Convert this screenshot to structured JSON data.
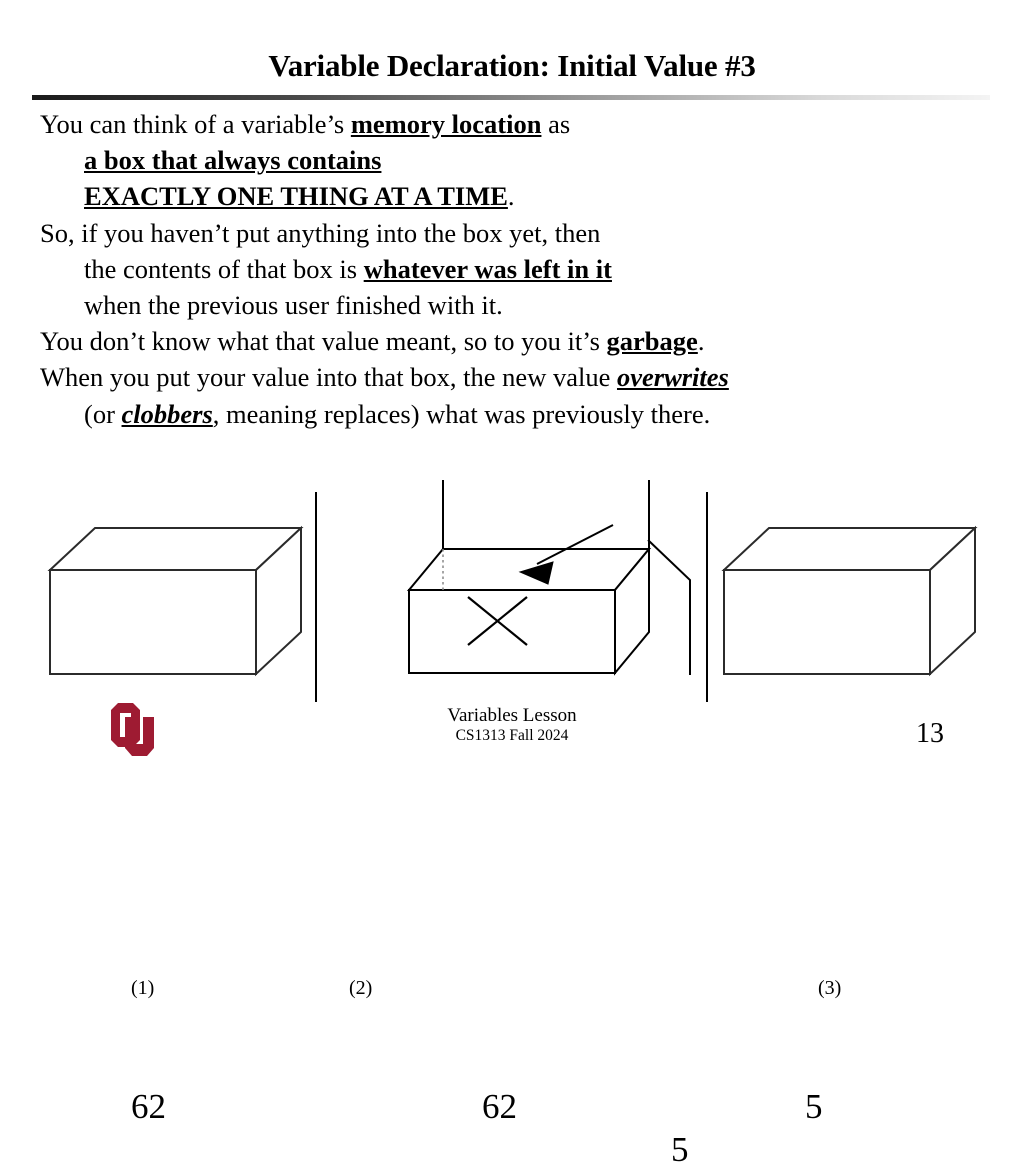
{
  "slide": {
    "title": "Variable Declaration: Initial Value #3",
    "page_number": "13"
  },
  "body": {
    "lines": [
      {
        "indent": 0,
        "segments": [
          {
            "text": "You can think of a variable’s ",
            "style": "plain"
          },
          {
            "text": "memory location",
            "style": "bold-underline"
          },
          {
            "text": " as",
            "style": "plain"
          }
        ]
      },
      {
        "indent": 1,
        "segments": [
          {
            "text": "a box that always contains",
            "style": "bold-underline"
          }
        ]
      },
      {
        "indent": 1,
        "segments": [
          {
            "text": "EXACTLY ONE THING AT A TIME",
            "style": "bold-underline"
          },
          {
            "text": ".",
            "style": "plain"
          }
        ]
      },
      {
        "indent": 0,
        "segments": [
          {
            "text": "So, if you haven’t put anything into the box yet, then",
            "style": "plain"
          }
        ]
      },
      {
        "indent": 1,
        "segments": [
          {
            "text": "the contents of that box is ",
            "style": "plain"
          },
          {
            "text": "whatever was left in it",
            "style": "bold-underline"
          }
        ]
      },
      {
        "indent": 1,
        "segments": [
          {
            "text": "when the previous user finished with it.",
            "style": "plain"
          }
        ]
      },
      {
        "indent": 0,
        "segments": [
          {
            "text": "You don’t know what that value meant, so to you it’s ",
            "style": "plain"
          },
          {
            "text": "garbage",
            "style": "bold-underline"
          },
          {
            "text": ".",
            "style": "plain"
          }
        ]
      },
      {
        "indent": 0,
        "segments": [
          {
            "text": "When you put your value into that box, the new value ",
            "style": "plain"
          },
          {
            "text": "overwrites",
            "style": "bold-italic-underline"
          }
        ]
      },
      {
        "indent": 1,
        "segments": [
          {
            "text": "(or ",
            "style": "plain"
          },
          {
            "text": "clobbers",
            "style": "bold-italic-underline"
          },
          {
            "text": ", meaning replaces) what was previously there.",
            "style": "plain"
          }
        ]
      }
    ]
  },
  "diagram": {
    "panels": [
      {
        "label": "(1)",
        "value": "62",
        "state": "closed-box-with-old-value"
      },
      {
        "label": "(2)",
        "value": "62",
        "crossed_out": true,
        "incoming_value": "5",
        "state": "open-box-value-crossed-out"
      },
      {
        "label": "(3)",
        "value": "5",
        "state": "closed-box-with-new-value"
      }
    ],
    "arrow_note": "arrow from new value 5 pointing into the open box"
  },
  "footer": {
    "lesson": "Variables Lesson",
    "course": "CS1313 Fall 2024",
    "logo_alt": "ou-logo",
    "logo_color": "#9E1B32"
  },
  "colors": {
    "text": "#000000",
    "background": "#FFFFFF",
    "logo_crimson": "#9E1B32",
    "box_stroke": "#000000"
  }
}
